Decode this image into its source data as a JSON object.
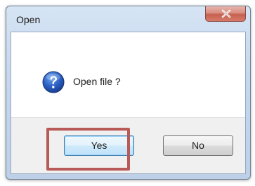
{
  "dialog": {
    "title": "Open",
    "message": "Open file ?",
    "icon": "question-icon",
    "buttons": {
      "yes_label": "Yes",
      "no_label": "No"
    },
    "close_icon": "close-icon"
  },
  "colors": {
    "highlight": "#b85a57",
    "close_button": "#c6604f",
    "default_button_border": "#3c7fb1"
  }
}
